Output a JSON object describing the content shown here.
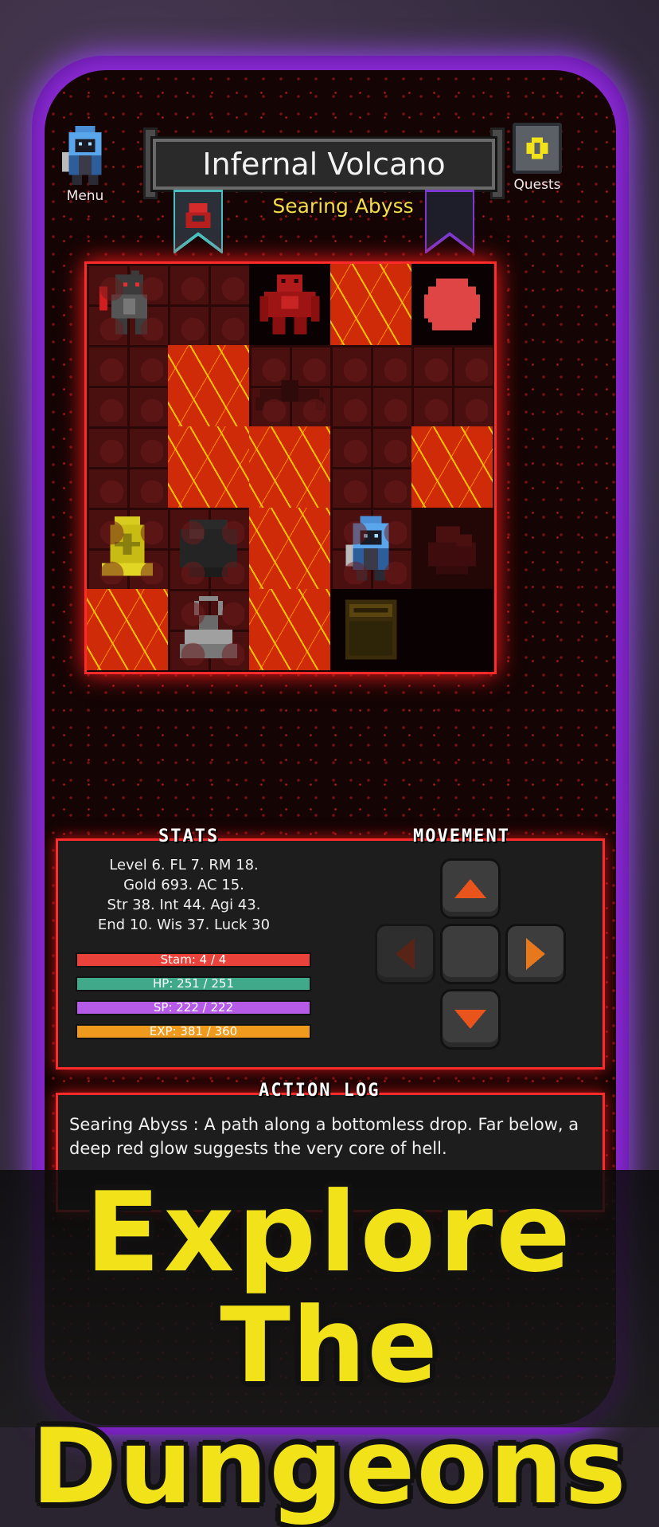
{
  "header": {
    "location_title": "Infernal Volcano",
    "area_name": "Searing Abyss",
    "menu_label": "Menu",
    "quests_label": "Quests"
  },
  "stats": {
    "heading": "STATS",
    "lines": [
      "Level 6. FL 7. RM 18.",
      "Gold 693. AC 15.",
      "Str 38. Int 44. Agi 43.",
      "End 10. Wis 37. Luck 30"
    ],
    "bars": [
      {
        "label": "Stam: 4 / 4",
        "fill": 1.0,
        "color": "#e8423a"
      },
      {
        "label": "HP: 251 / 251",
        "fill": 1.0,
        "color": "#3fa98a"
      },
      {
        "label": "SP: 222 / 222",
        "fill": 1.0,
        "color": "#b65ae8"
      },
      {
        "label": "EXP: 381 / 360",
        "fill": 1.0,
        "color": "#ef9a1c"
      }
    ]
  },
  "movement": {
    "heading": "MOVEMENT"
  },
  "log": {
    "heading": "ACTION LOG",
    "text": "Searing Abyss : A path along a bottomless drop. Far below, a deep red glow suggests the very core of hell."
  },
  "promo": {
    "line1": "Explore",
    "line2": "The Dungeons"
  },
  "map": {
    "tiles": [
      [
        "floor-knight",
        "floor",
        "dark-golem",
        "lava",
        "dark-slime"
      ],
      [
        "floor",
        "lava",
        "floor-bat",
        "floor",
        "floor"
      ],
      [
        "floor",
        "lava",
        "lava",
        "floor",
        "lava"
      ],
      [
        "floor-shrine",
        "floor-rock",
        "lava",
        "floor-player",
        "darkfloor-rubble"
      ],
      [
        "lava",
        "floor-anvil",
        "lava",
        "dark-chest",
        "dark"
      ]
    ]
  }
}
